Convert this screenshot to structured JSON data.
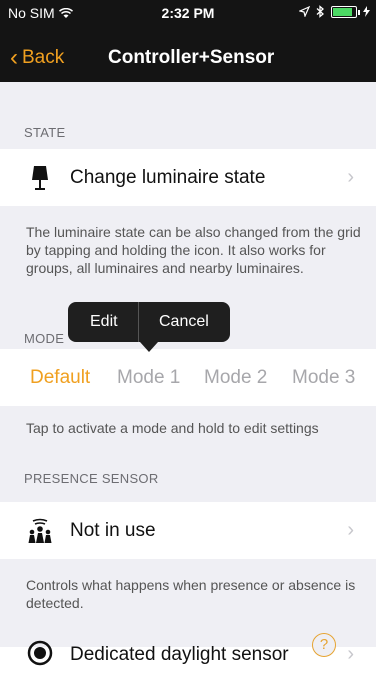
{
  "status_bar": {
    "carrier": "No SIM",
    "time": "2:32 PM"
  },
  "nav": {
    "back_label": "Back",
    "title": "Controller+Sensor"
  },
  "state": {
    "header": "STATE",
    "cell_label": "Change luminaire state",
    "footer": "The luminaire state can be also changed from the grid by tapping and holding the icon. It also works for groups, all luminaires and nearby luminaires."
  },
  "mode": {
    "header": "MODE",
    "items": [
      "Default",
      "Mode 1",
      "Mode 2",
      "Mode 3"
    ],
    "selected": "Default",
    "footer": "Tap to activate a mode and hold to edit settings"
  },
  "tooltip": {
    "edit": "Edit",
    "cancel": "Cancel"
  },
  "presence": {
    "header": "PRESENCE SENSOR",
    "cell_label": "Not in use",
    "footer": "Controls what happens when presence or absence is detected."
  },
  "daylight": {
    "cell_label": "Dedicated daylight sensor"
  },
  "help_symbol": "?",
  "colors": {
    "accent": "#f0a020",
    "topbar": "#141414",
    "background": "#efeff4"
  }
}
